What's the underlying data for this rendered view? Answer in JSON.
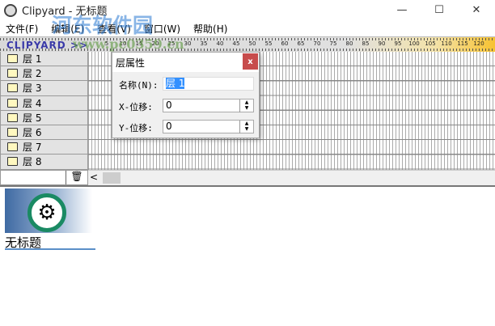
{
  "window": {
    "title": "Clipyard - 无标题",
    "minimize": "—",
    "maximize": "☐",
    "close": "✕"
  },
  "menu": [
    "文件(F)",
    "编辑(E)",
    "查看(V)",
    "窗口(W)",
    "帮助(H)"
  ],
  "ruler": {
    "logo": "CLIPYARD >>",
    "ticks": [
      "5",
      "10",
      "15",
      "20",
      "25",
      "30",
      "35",
      "40",
      "45",
      "50",
      "55",
      "60",
      "65",
      "70",
      "75",
      "80",
      "85",
      "90",
      "95",
      "100",
      "105",
      "110",
      "115",
      "120"
    ]
  },
  "layers": [
    "层 1",
    "层 2",
    "层 3",
    "层 4",
    "层 5",
    "层 6",
    "层 7",
    "层 8"
  ],
  "trash_icon": "🗑",
  "scroll_left": "<",
  "document": {
    "name": "无标题"
  },
  "dialog": {
    "title": "层属性",
    "close": "x",
    "name_label": "名称(N):",
    "name_value": "层 1",
    "x_label": "X-位移:",
    "x_value": "0",
    "y_label": "Y-位移:",
    "y_value": "0",
    "up": "▲",
    "down": "▼"
  },
  "watermark": {
    "site": "河东软件园",
    "url": "www.pc0359.cn"
  }
}
